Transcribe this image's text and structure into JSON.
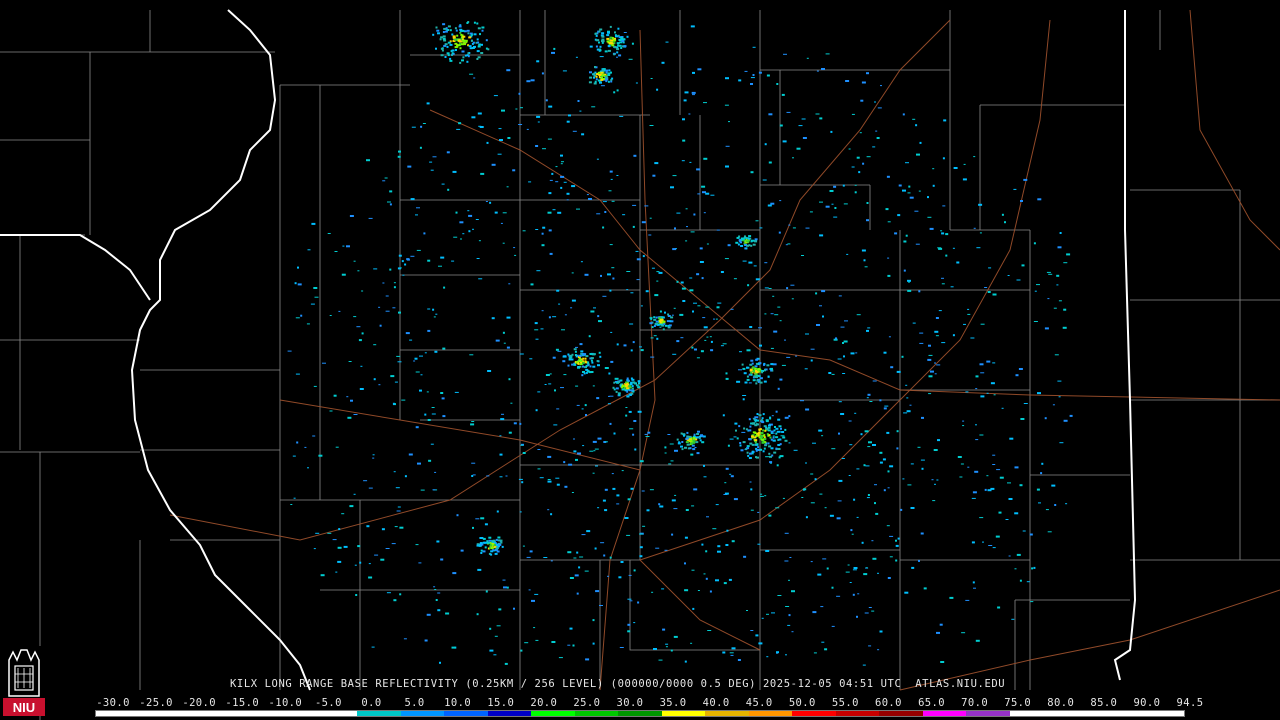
{
  "caption": {
    "text": "KILX LONG RANGE BASE REFLECTIVITY (0.25KM / 256 LEVEL) (000000/0000 0.5 DEG) 2025-12-05 04:51 UTC  ATLAS.NIU.EDU"
  },
  "colorbar": {
    "labels": [
      "-30.0",
      "-25.0",
      "-20.0",
      "-15.0",
      "-10.0",
      "-5.0",
      "0.0",
      "5.0",
      "10.0",
      "15.0",
      "20.0",
      "25.0",
      "30.0",
      "35.0",
      "40.0",
      "45.0",
      "50.0",
      "55.0",
      "60.0",
      "65.0",
      "70.0",
      "75.0",
      "80.0",
      "85.0",
      "90.0",
      "94.5"
    ],
    "colors": [
      "#ffffff",
      "#ffffff",
      "#ffffff",
      "#ffffff",
      "#ffffff",
      "#ffffff",
      "#00c8c8",
      "#0096ff",
      "#0064ff",
      "#0000c8",
      "#00ff00",
      "#00c800",
      "#009600",
      "#ffff00",
      "#e6b400",
      "#ff9600",
      "#ff0000",
      "#c80000",
      "#960000",
      "#ff00ff",
      "#9632c8",
      "#ffffff",
      "#ffffff",
      "#ffffff",
      "#ffffff"
    ]
  },
  "logo": {
    "text": "NIU",
    "color": "#c8102e"
  },
  "radar": {
    "site": "KILX",
    "echo_colors": [
      "#1e90ff",
      "#00bfff",
      "#00ced1",
      "#20b2aa",
      "#32cd32",
      "#7cfc00",
      "#ffd700"
    ]
  }
}
